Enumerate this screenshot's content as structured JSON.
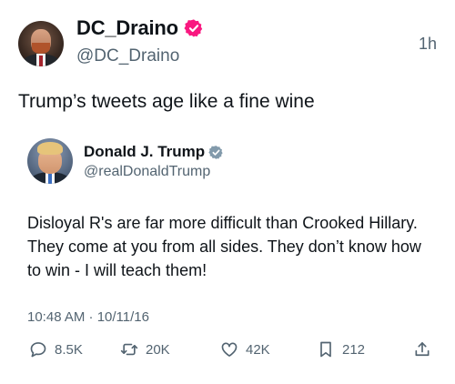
{
  "author": {
    "name": "DC_Draino",
    "handle": "@DC_Draino",
    "verified_color": "#f91880",
    "avatar_icon": "profile-photo"
  },
  "time_ago": "1h",
  "tweet_text": "Trump’s tweets age like a fine wine",
  "quoted": {
    "name": "Donald J. Trump",
    "handle": "@realDonaldTrump",
    "verified_color": "#829aab",
    "avatar_icon": "profile-photo",
    "text": "Disloyal R's are far more difficult than Crooked Hillary. They come at you from all sides. They don’t know how to win - I will teach them!",
    "timestamp": "10:48 AM · 10/11/16"
  },
  "actions": {
    "replies": "8.5K",
    "reposts": "20K",
    "likes": "42K",
    "bookmarks": "212"
  },
  "colors": {
    "text_primary": "#0f1419",
    "text_secondary": "#536471",
    "background": "#ffffff"
  }
}
